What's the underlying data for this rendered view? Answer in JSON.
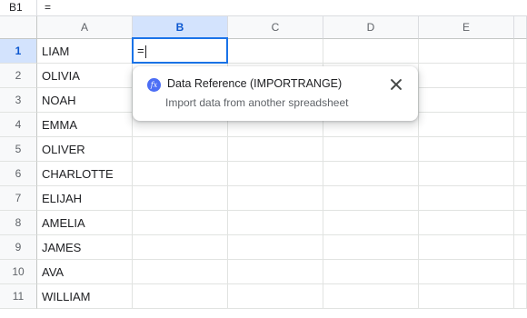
{
  "formula_bar": {
    "cell_ref": "B1",
    "content": "="
  },
  "columns": [
    "A",
    "B",
    "C",
    "D",
    "E"
  ],
  "rows": [
    "1",
    "2",
    "3",
    "4",
    "5",
    "6",
    "7",
    "8",
    "9",
    "10",
    "11"
  ],
  "column_a": [
    "LIAM",
    "OLIVIA",
    "NOAH",
    "EMMA",
    "OLIVER",
    "CHARLOTTE",
    "ELIJAH",
    "AMELIA",
    "JAMES",
    "AVA",
    "WILLIAM"
  ],
  "active_cell": {
    "ref": "B1",
    "value": "="
  },
  "suggestion": {
    "icon": "fx-icon",
    "fx_glyph": "fx",
    "title": "Data Reference (IMPORTRANGE)",
    "subtitle": "Import data from another spreadsheet"
  },
  "colors": {
    "accent": "#1a73e8",
    "selected_header": "#d3e3fd",
    "fx_badge": "#4c6ef5"
  }
}
